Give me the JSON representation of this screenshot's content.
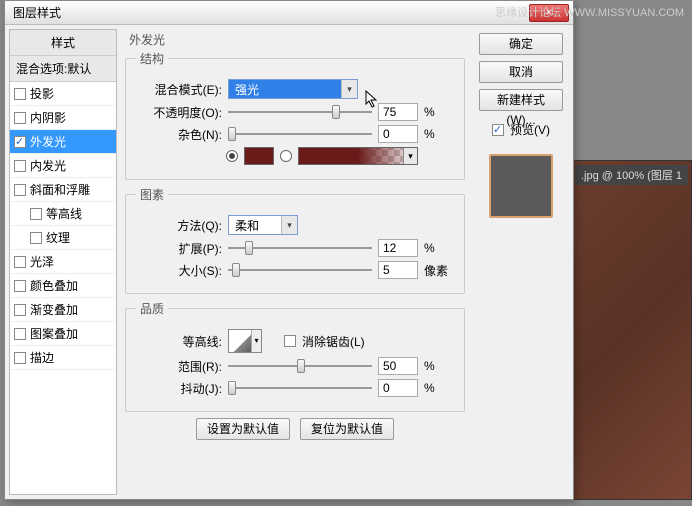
{
  "watermark": "思缘设计论坛  WWW.MISSYUAN.COM",
  "doc_tab": ".jpg @ 100% (图层 1",
  "dialog": {
    "title": "图层样式",
    "close": "×",
    "left": {
      "header": "样式",
      "selected": "混合选项:默认",
      "items": [
        {
          "label": "投影",
          "checked": false
        },
        {
          "label": "内阴影",
          "checked": false
        },
        {
          "label": "外发光",
          "checked": true,
          "active": true
        },
        {
          "label": "内发光",
          "checked": false
        },
        {
          "label": "斜面和浮雕",
          "checked": false
        },
        {
          "label": "等高线",
          "checked": false,
          "indent": true
        },
        {
          "label": "纹理",
          "checked": false,
          "indent": true
        },
        {
          "label": "光泽",
          "checked": false
        },
        {
          "label": "颜色叠加",
          "checked": false
        },
        {
          "label": "渐变叠加",
          "checked": false
        },
        {
          "label": "图案叠加",
          "checked": false
        },
        {
          "label": "描边",
          "checked": false
        }
      ]
    },
    "center": {
      "title": "外发光",
      "structure": {
        "legend": "结构",
        "blend_label": "混合模式(E):",
        "blend_value": "强光",
        "opacity_label": "不透明度(O):",
        "opacity_value": "75",
        "opacity_unit": "%",
        "noise_label": "杂色(N):",
        "noise_value": "0",
        "noise_unit": "%"
      },
      "elements": {
        "legend": "图素",
        "method_label": "方法(Q):",
        "method_value": "柔和",
        "spread_label": "扩展(P):",
        "spread_value": "12",
        "spread_unit": "%",
        "size_label": "大小(S):",
        "size_value": "5",
        "size_unit": "像素"
      },
      "quality": {
        "legend": "品质",
        "contour_label": "等高线:",
        "anti_label": "消除锯齿(L)",
        "range_label": "范围(R):",
        "range_value": "50",
        "range_unit": "%",
        "jitter_label": "抖动(J):",
        "jitter_value": "0",
        "jitter_unit": "%"
      },
      "btn_default": "设置为默认值",
      "btn_reset": "复位为默认值"
    },
    "right": {
      "ok": "确定",
      "cancel": "取消",
      "newstyle": "新建样式(W)...",
      "preview": "预览(V)"
    }
  }
}
